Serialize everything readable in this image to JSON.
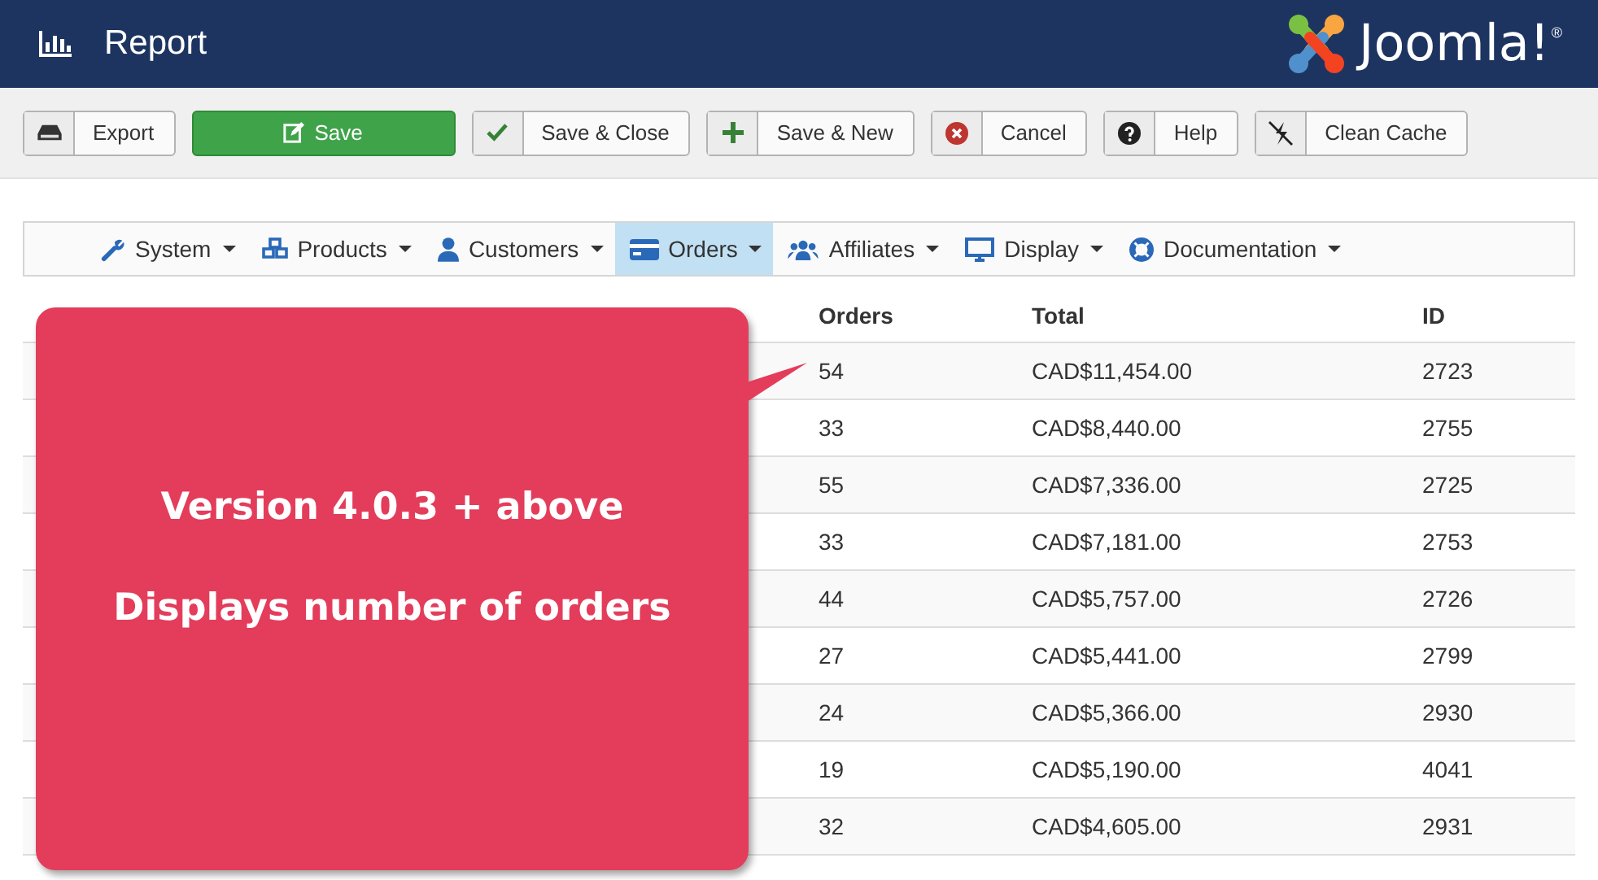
{
  "header": {
    "title": "Report",
    "logo_text": "Joomla!",
    "logo_mark": "®"
  },
  "toolbar": [
    {
      "label": "Export",
      "kind": "default"
    },
    {
      "label": "Save",
      "kind": "primary"
    },
    {
      "label": "Save & Close",
      "kind": "default"
    },
    {
      "label": "Save & New",
      "kind": "default"
    },
    {
      "label": "Cancel",
      "kind": "default"
    },
    {
      "label": "Help",
      "kind": "default"
    },
    {
      "label": "Clean Cache",
      "kind": "default"
    }
  ],
  "menu": [
    {
      "label": "System",
      "selected": false
    },
    {
      "label": "Products",
      "selected": false
    },
    {
      "label": "Customers",
      "selected": false
    },
    {
      "label": "Orders",
      "selected": true
    },
    {
      "label": "Affiliates",
      "selected": false
    },
    {
      "label": "Display",
      "selected": false
    },
    {
      "label": "Documentation",
      "selected": false
    }
  ],
  "table": {
    "columns": [
      "Orders",
      "Total",
      "ID"
    ],
    "rows": [
      [
        "54",
        "CAD$11,454.00",
        "2723"
      ],
      [
        "33",
        "CAD$8,440.00",
        "2755"
      ],
      [
        "55",
        "CAD$7,336.00",
        "2725"
      ],
      [
        "33",
        "CAD$7,181.00",
        "2753"
      ],
      [
        "44",
        "CAD$5,757.00",
        "2726"
      ],
      [
        "27",
        "CAD$5,441.00",
        "2799"
      ],
      [
        "24",
        "CAD$5,366.00",
        "2930"
      ],
      [
        "19",
        "CAD$5,190.00",
        "4041"
      ],
      [
        "32",
        "CAD$4,605.00",
        "2931"
      ]
    ]
  },
  "callout": {
    "lines": [
      "Version 4.0.3 + above",
      "Displays number of orders"
    ]
  }
}
